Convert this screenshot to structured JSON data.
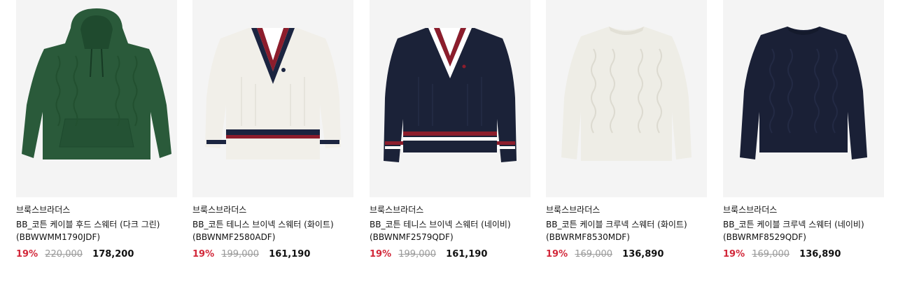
{
  "products": [
    {
      "brand": "브룩스브라더스",
      "name": "BB_코튼 케이블 후드 스웨터 (다크 그린)",
      "code": "(BBWWMM1790JDF)",
      "discount": "19%",
      "original_price": "220,000",
      "sale_price": "178,200",
      "colors": {
        "body": "#2a5a3a"
      }
    },
    {
      "brand": "브룩스브라더스",
      "name": "BB_코튼 테니스 브이넥 스웨터 (화이트)",
      "code": "(BBWNMF2580ADF)",
      "discount": "19%",
      "original_price": "199,000",
      "sale_price": "161,190",
      "colors": {
        "body": "#f1efe9",
        "stripe1": "#1b2440",
        "stripe2": "#8c1d2c"
      }
    },
    {
      "brand": "브룩스브라더스",
      "name": "BB_코튼 테니스 브이넥 스웨터 (네이비)",
      "code": "(BBWNMF2579QDF)",
      "discount": "19%",
      "original_price": "199,000",
      "sale_price": "161,190",
      "colors": {
        "body": "#1b2238",
        "stripe1": "#ffffff",
        "stripe2": "#8c1d2c"
      }
    },
    {
      "brand": "브룩스브라더스",
      "name": "BB_코튼 케이블 크루넥 스웨터 (화이트)",
      "code": "(BBWRMF8530MDF)",
      "discount": "19%",
      "original_price": "169,000",
      "sale_price": "136,890",
      "colors": {
        "body": "#eeede6"
      }
    },
    {
      "brand": "브룩스브라더스",
      "name": "BB_코튼 케이블 크루넥 스웨터 (네이비)",
      "code": "(BBWRMF8529QDF)",
      "discount": "19%",
      "original_price": "169,000",
      "sale_price": "136,890",
      "colors": {
        "body": "#1a2036"
      }
    }
  ]
}
